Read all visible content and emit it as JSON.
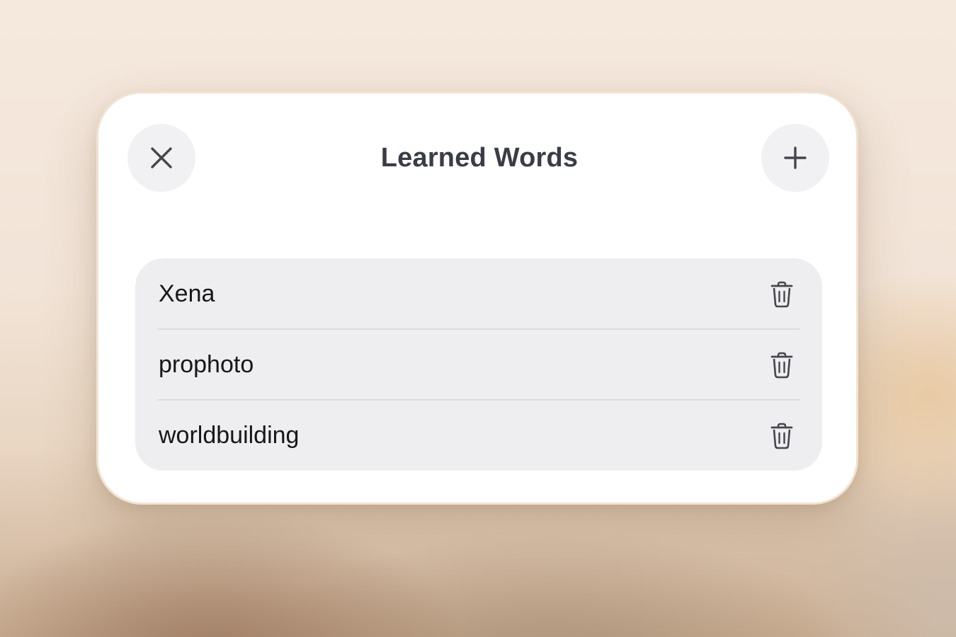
{
  "dialog": {
    "title": "Learned Words",
    "close_icon": "close-icon",
    "add_icon": "plus-icon"
  },
  "words": [
    {
      "label": "Xena",
      "icon": "trash-icon"
    },
    {
      "label": "prophoto",
      "icon": "trash-icon"
    },
    {
      "label": "worldbuilding",
      "icon": "trash-icon"
    }
  ],
  "colors": {
    "panel": "#ffffff",
    "list_bg": "#eeeef0",
    "title_text": "#3a3d45",
    "icon": "#44464d"
  }
}
